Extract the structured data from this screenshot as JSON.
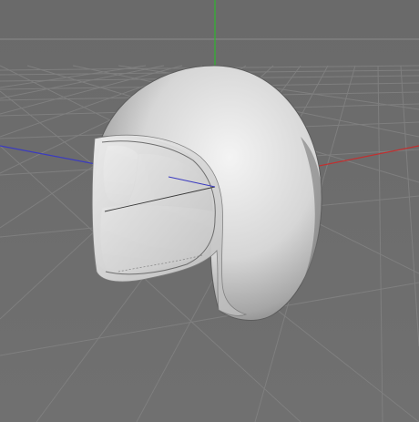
{
  "viewport": {
    "view": "perspective",
    "background_color": "#6c6c6c",
    "grid": true,
    "grid_color": "#7d7d7d",
    "axis_colors": {
      "x": "#c03030",
      "y": "#2fb52f",
      "z": "#3b3bbf"
    },
    "object": {
      "name": "helmet",
      "shading": "smooth-gray"
    }
  }
}
